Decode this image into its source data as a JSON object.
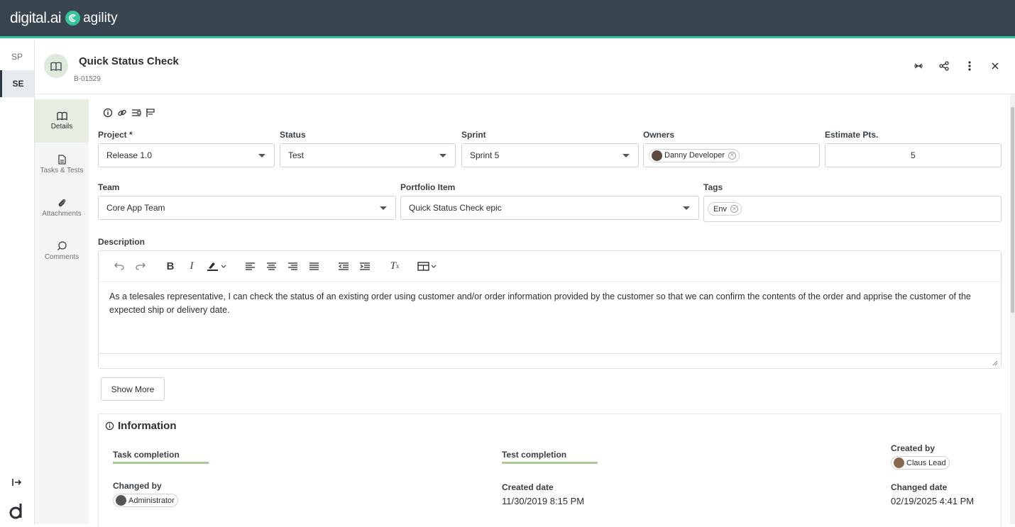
{
  "header": {
    "brand_digital": "digital.ai",
    "brand_product": "agility"
  },
  "rail": {
    "items": [
      {
        "label": "SP"
      },
      {
        "label": "SE"
      }
    ]
  },
  "story": {
    "title": "Quick Status Check",
    "number": "B-01529"
  },
  "tabs": [
    {
      "label": "Details"
    },
    {
      "label": "Tasks & Tests"
    },
    {
      "label": "Attachments"
    },
    {
      "label": "Comments"
    }
  ],
  "fields": {
    "project": {
      "label": "Project *",
      "value": "Release 1.0"
    },
    "status": {
      "label": "Status",
      "value": "Test"
    },
    "sprint": {
      "label": "Sprint",
      "value": "Sprint 5"
    },
    "owners": {
      "label": "Owners",
      "value": "Danny Developer"
    },
    "estimate": {
      "label": "Estimate Pts.",
      "value": "5"
    },
    "team": {
      "label": "Team",
      "value": "Core App Team"
    },
    "portfolio": {
      "label": "Portfolio Item",
      "value": "Quick Status Check epic"
    },
    "tags": {
      "label": "Tags",
      "value": "Env"
    }
  },
  "description": {
    "label": "Description",
    "text": "As a telesales representative, I can check the status of an existing order using customer and/or order information provided by the customer so that we can confirm the contents of the order and apprise the customer of the expected ship or delivery date."
  },
  "show_more": "Show More",
  "info": {
    "title": "Information",
    "task_completion": "Task completion",
    "test_completion": "Test completion",
    "created_by_label": "Created by",
    "created_by": "Claus Lead",
    "changed_by_label": "Changed by",
    "changed_by": "Administrator",
    "created_date_label": "Created date",
    "created_date": "11/30/2019 8:15 PM",
    "changed_date_label": "Changed date",
    "changed_date": "02/19/2025 4:41 PM"
  },
  "colors": {
    "header_bg": "#38444f",
    "accent": "#35c39a",
    "progress": "#a9c996"
  }
}
